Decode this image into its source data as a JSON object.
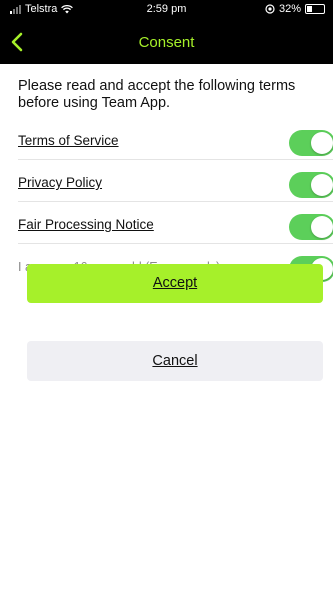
{
  "status_bar": {
    "carrier": "Telstra",
    "time": "2:59 pm",
    "battery": "32%",
    "icons": [
      "signal-icon",
      "wifi-icon",
      "location-icon",
      "battery-icon"
    ]
  },
  "nav": {
    "title": "Consent",
    "back_icon": "chevron-left-icon"
  },
  "intro_text": "Please read and accept the following terms before using Team App.",
  "terms": [
    {
      "label": "Terms of Service",
      "enabled": true,
      "link": true
    },
    {
      "label": "Privacy Policy",
      "enabled": true,
      "link": true
    },
    {
      "label": "Fair Processing Notice",
      "enabled": true,
      "link": true
    },
    {
      "label": "I am over 16 years old (Europe only)",
      "enabled": true,
      "link": false
    }
  ],
  "buttons": {
    "accept": "Accept",
    "cancel": "Cancel"
  },
  "colors": {
    "accent": "#a6f02a",
    "toggle_on": "#5ccf5a",
    "nav_background": "#000000",
    "cancel_background": "#efeff3"
  }
}
